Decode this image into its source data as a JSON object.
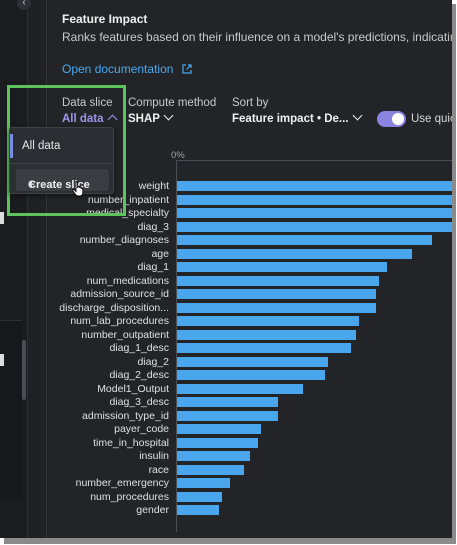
{
  "panel": {
    "title": "Feature Impact",
    "subtitle": "Ranks features based on their influence on a model's predictions, indicating",
    "doc_link": "Open documentation"
  },
  "controls": {
    "data_slice": {
      "label": "Data slice",
      "value": "All data"
    },
    "compute_method": {
      "label": "Compute method",
      "value": "SHAP"
    },
    "sort_by": {
      "label": "Sort by",
      "value": "Feature impact • De..."
    },
    "toggle": {
      "label": "Use quic",
      "on": true
    }
  },
  "dropdown": {
    "items": [
      "All data"
    ],
    "create_label": "Create slice"
  },
  "colors": {
    "accent": "#8a83e0",
    "bar": "#49a6ec",
    "link": "#4aa8f0",
    "highlight": "#5dc35d"
  },
  "chart_data": {
    "type": "bar",
    "orientation": "horizontal",
    "axis_tick": "0%",
    "categories": [
      "weight",
      "number_inpatient",
      "medical_specialty",
      "diag_3",
      "number_diagnoses",
      "age",
      "diag_1",
      "num_medications",
      "admission_source_id",
      "discharge_disposition...",
      "num_lab_procedures",
      "number_outpatient",
      "diag_1_desc",
      "diag_2",
      "diag_2_desc",
      "Model1_Output",
      "diag_3_desc",
      "admission_type_id",
      "payer_code",
      "time_in_hospital",
      "insulin",
      "race",
      "number_emergency",
      "num_procedures",
      "gender"
    ],
    "values": [
      100,
      100,
      100,
      100,
      91,
      84,
      75,
      72,
      71,
      71,
      65,
      64,
      62,
      54,
      53,
      45,
      36,
      36,
      30,
      29,
      26,
      24,
      19,
      16,
      15
    ],
    "xlim": [
      0,
      100
    ]
  }
}
